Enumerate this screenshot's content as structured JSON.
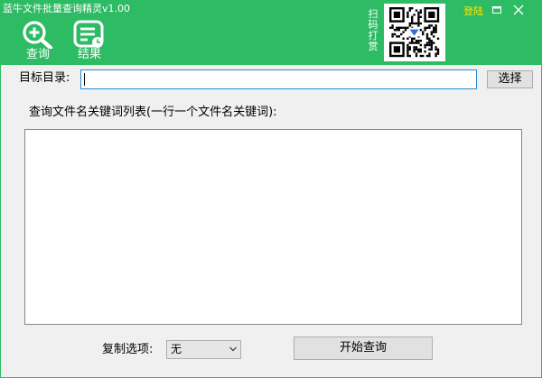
{
  "app": {
    "title": "蓝牛文件批量查询精灵v1.00"
  },
  "toolbar": {
    "query_label": "查询",
    "result_label": "结果"
  },
  "header": {
    "donate_label": "扫码打赏",
    "login_label": "登陆",
    "qr_icon": "qr-code-icon",
    "colors": {
      "header_bg": "#2dbb64",
      "login_text": "#ffe600"
    }
  },
  "form": {
    "target_dir_label": "目标目录:",
    "target_dir_value": "",
    "select_button_label": "选择",
    "keywords_label": "查询文件名关键词列表(一行一个文件名关键词):",
    "keywords_value": "",
    "copy_option_label": "复制选项:",
    "copy_option_value": "无",
    "start_button_label": "开始查询"
  }
}
